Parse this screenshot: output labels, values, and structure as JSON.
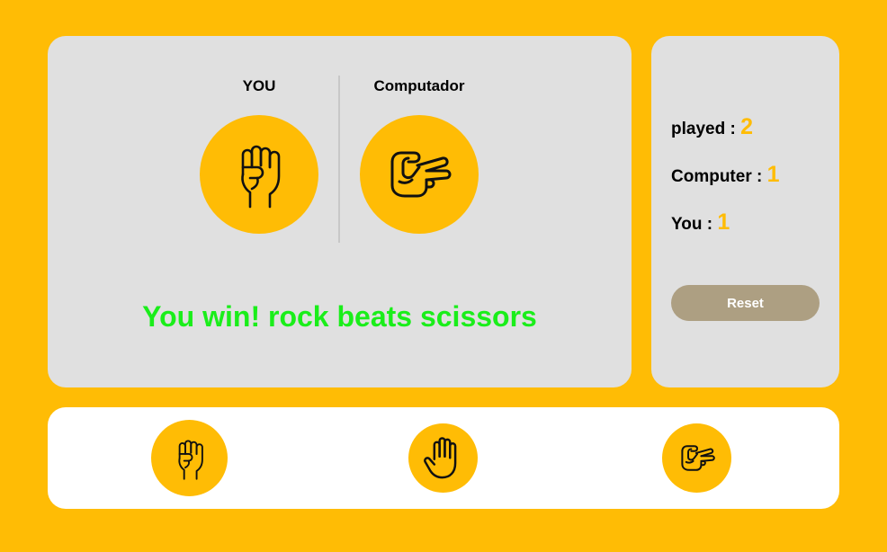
{
  "players": {
    "you_label": "YOU",
    "computer_label": "Computador",
    "you_choice": "rock",
    "computer_choice": "scissors"
  },
  "result": {
    "message": "You win! rock beats scissors"
  },
  "score": {
    "played_label": "played : ",
    "played_value": "2",
    "computer_label": "Computer : ",
    "computer_value": "1",
    "you_label": "You : ",
    "you_value": "1"
  },
  "reset_label": "Reset",
  "choices": [
    {
      "name": "rock",
      "icon": "rock-hand-icon"
    },
    {
      "name": "paper",
      "icon": "paper-hand-icon"
    },
    {
      "name": "scissors",
      "icon": "scissors-hand-icon"
    }
  ],
  "colors": {
    "background": "#ffbc05",
    "panel": "#e0e0e0",
    "accent": "#ffbc05",
    "result_text": "#1aee1a",
    "reset_button": "#ad9f82"
  }
}
